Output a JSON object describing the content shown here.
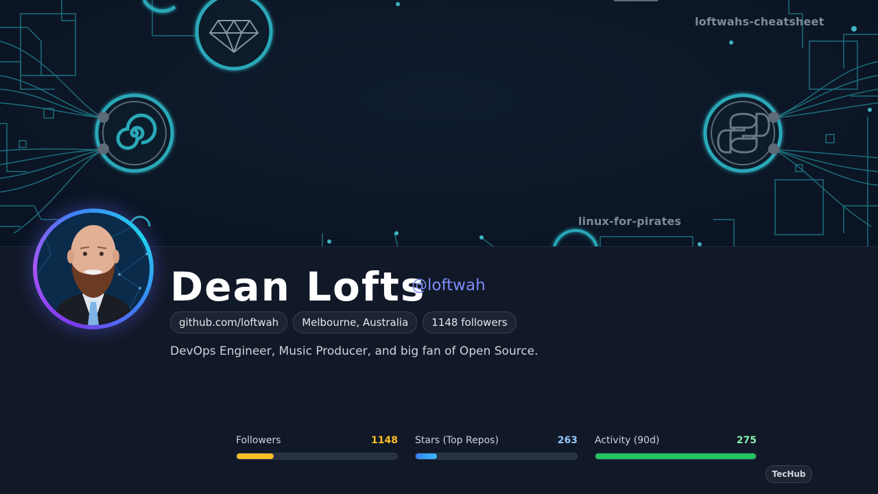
{
  "banner": {
    "labels": [
      "loftwahs-cheatsheet",
      "linux-for-pirates"
    ],
    "icons": [
      "diamond-icon",
      "spiral-icon",
      "python-icon"
    ]
  },
  "profile": {
    "name": "Dean Lofts",
    "handle": "@loftwah",
    "chips": [
      "github.com/loftwah",
      "Melbourne, Australia",
      "1148 followers"
    ],
    "bio": "DevOps Engineer, Music Producer, and big fan of Open Source."
  },
  "stats": [
    {
      "label": "Followers",
      "value": "1148",
      "fill_fraction": 0.23,
      "color": "#fbbf24"
    },
    {
      "label": "Stars (Top Repos)",
      "value": "263",
      "fill_fraction": 0.13,
      "color": "#60a5fa"
    },
    {
      "label": "Activity (90d)",
      "value": "275",
      "fill_fraction": 1.0,
      "color": "#22c55e"
    }
  ],
  "brand": {
    "badge": "TecHub"
  },
  "colors": {
    "accent": "#7c8cf8",
    "circuit": "#2aa8b8",
    "background": "#111827"
  }
}
